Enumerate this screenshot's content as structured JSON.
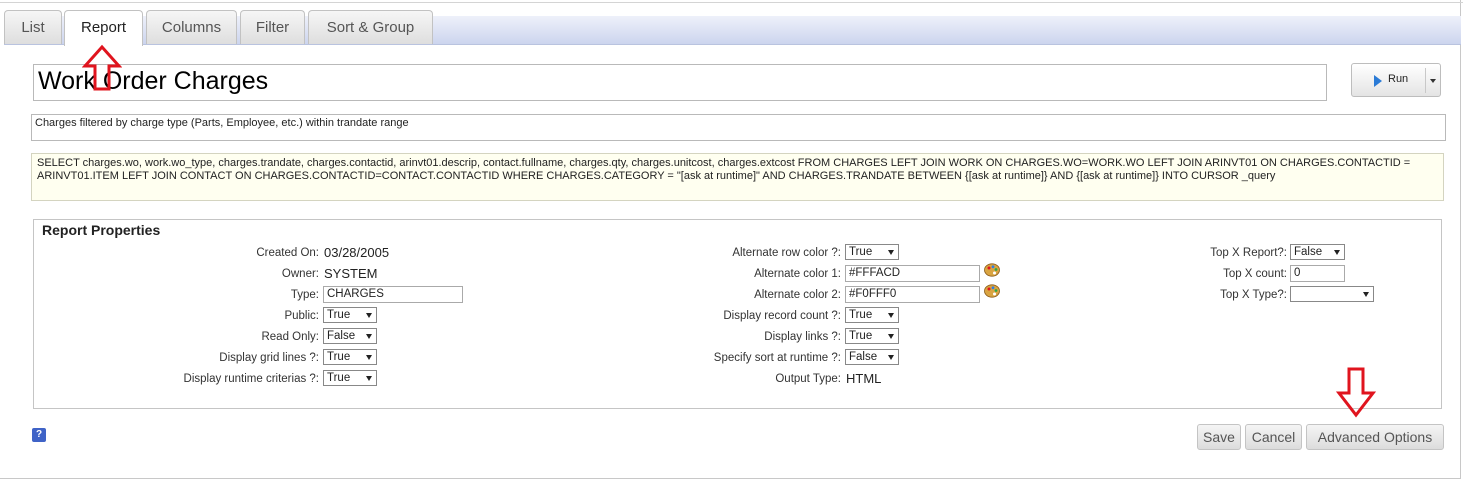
{
  "tabs": [
    {
      "label": "List"
    },
    {
      "label": "Report"
    },
    {
      "label": "Columns"
    },
    {
      "label": "Filter"
    },
    {
      "label": "Sort & Group"
    }
  ],
  "report": {
    "title": "Work Order Charges",
    "description": "Charges filtered by charge type (Parts, Employee, etc.) within trandate range",
    "sql": "SELECT charges.wo, work.wo_type, charges.trandate, charges.contactid, arinvt01.descrip, contact.fullname, charges.qty, charges.unitcost, charges.extcost FROM CHARGES LEFT JOIN WORK ON CHARGES.WO=WORK.WO LEFT JOIN ARINVT01 ON CHARGES.CONTACTID = ARINVT01.ITEM LEFT JOIN CONTACT ON CHARGES.CONTACTID=CONTACT.CONTACTID WHERE CHARGES.CATEGORY = \"[ask at runtime]\" AND CHARGES.TRANDATE BETWEEN {[ask at runtime]} AND {[ask at runtime]} INTO CURSOR _query"
  },
  "run_button": {
    "label": "Run"
  },
  "properties": {
    "title": "Report Properties",
    "col1": {
      "created_on": {
        "label": "Created On:",
        "value": "03/28/2005"
      },
      "owner": {
        "label": "Owner:",
        "value": "SYSTEM"
      },
      "type": {
        "label": "Type:",
        "value": "CHARGES"
      },
      "public": {
        "label": "Public:",
        "value": "True"
      },
      "read_only": {
        "label": "Read Only:",
        "value": "False"
      },
      "grid_lines": {
        "label": "Display grid lines ?:",
        "value": "True"
      },
      "runtime_criterias": {
        "label": "Display runtime criterias ?:",
        "value": "True"
      }
    },
    "col2": {
      "alt_row_color": {
        "label": "Alternate row color ?:",
        "value": "True"
      },
      "alt_color1": {
        "label": "Alternate color 1:",
        "value": "#FFFACD"
      },
      "alt_color2": {
        "label": "Alternate color 2:",
        "value": "#F0FFF0"
      },
      "record_count": {
        "label": "Display record count ?:",
        "value": "True"
      },
      "display_links": {
        "label": "Display links ?:",
        "value": "True"
      },
      "sort_runtime": {
        "label": "Specify sort at runtime ?:",
        "value": "False"
      },
      "output_type": {
        "label": "Output Type:",
        "value": "HTML"
      }
    },
    "col3": {
      "topx_report": {
        "label": "Top X Report?:",
        "value": "False"
      },
      "topx_count": {
        "label": "Top X count:",
        "value": "0"
      },
      "topx_type": {
        "label": "Top X Type?:",
        "value": ""
      }
    }
  },
  "buttons": {
    "save": "Save",
    "cancel": "Cancel",
    "advanced": "Advanced Options"
  },
  "help_glyph": "?",
  "colors": {
    "annotation_red": "#e0141e",
    "tab_bar": "#ccd5ee",
    "sql_bg": "#fffff0"
  }
}
